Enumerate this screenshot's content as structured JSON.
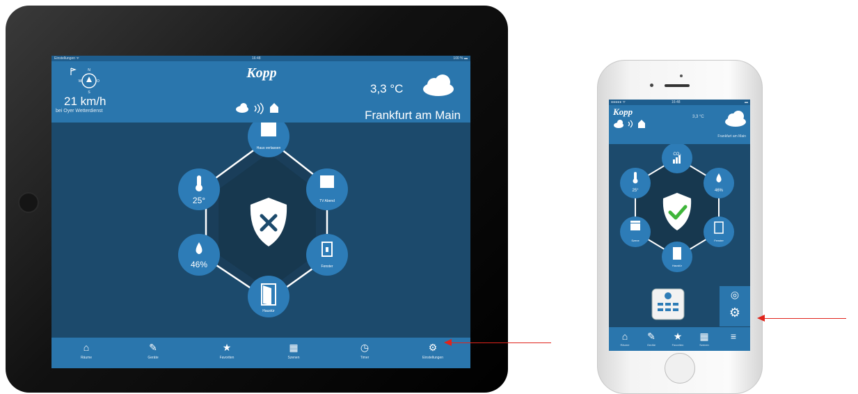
{
  "ipad": {
    "status": {
      "left": "Einstellungen ᯤ",
      "time": "16:48",
      "right": "100 % ▬"
    },
    "header": {
      "brand": "Kopp",
      "wind_speed": "21 km/h",
      "wind_location": "bei Oyer Wetterdienst",
      "temperature": "3,3 °C",
      "city": "Frankfurt am Main"
    },
    "security": {
      "status": "disarmed",
      "nodes": [
        {
          "id": "scene-top",
          "icon": "scene-clapper-icon",
          "label": "Haus verlassen"
        },
        {
          "id": "scene-right",
          "icon": "scene-clapper-icon",
          "label": "TV Abend"
        },
        {
          "id": "window",
          "icon": "window-icon",
          "label": "Fenster"
        },
        {
          "id": "door",
          "icon": "door-icon",
          "label": "Haustür"
        },
        {
          "id": "humidity",
          "icon": "droplet-icon",
          "label": "46%"
        },
        {
          "id": "temperature",
          "icon": "thermometer-icon",
          "label": "25°"
        }
      ]
    },
    "tabs": [
      {
        "icon": "home-icon",
        "label": "Räume"
      },
      {
        "icon": "devices-icon",
        "label": "Geräte"
      },
      {
        "icon": "star-icon",
        "label": "Favoriten"
      },
      {
        "icon": "scenes-icon",
        "label": "Szenen"
      },
      {
        "icon": "clock-icon",
        "label": "Timer"
      },
      {
        "icon": "gear-icon",
        "label": "Einstellungen"
      }
    ]
  },
  "iphone": {
    "status": {
      "left": "●●●●● ᯤ",
      "time": "16:48",
      "right": "▬"
    },
    "header": {
      "brand": "Kopp",
      "temperature": "3,3 °C",
      "city": "Frankfurt am Main"
    },
    "security": {
      "status": "armed",
      "nodes": [
        {
          "id": "co2",
          "icon": "co2-icon",
          "label": "CO₂"
        },
        {
          "id": "humidity",
          "icon": "droplet-icon",
          "label": "46%"
        },
        {
          "id": "window",
          "icon": "window-icon",
          "label": "Fenster"
        },
        {
          "id": "door",
          "icon": "door-icon",
          "label": "Haustür"
        },
        {
          "id": "scene",
          "icon": "scene-clapper-icon",
          "label": "Szene"
        },
        {
          "id": "temperature",
          "icon": "thermometer-icon",
          "label": "25°"
        }
      ]
    },
    "tabs": [
      {
        "icon": "home-icon",
        "label": "Räume"
      },
      {
        "icon": "devices-icon",
        "label": "Geräte"
      },
      {
        "icon": "star-icon",
        "label": "Favoriten"
      },
      {
        "icon": "scenes-icon",
        "label": "Szenen"
      },
      {
        "icon": "menu-icon",
        "label": ""
      }
    ]
  },
  "colors": {
    "header_blue": "#2a76ad",
    "body_blue": "#1c4a6c",
    "node_blue": "#2d7cb7",
    "accent_green": "#3fb53a",
    "arrow_red": "#e0241b"
  }
}
